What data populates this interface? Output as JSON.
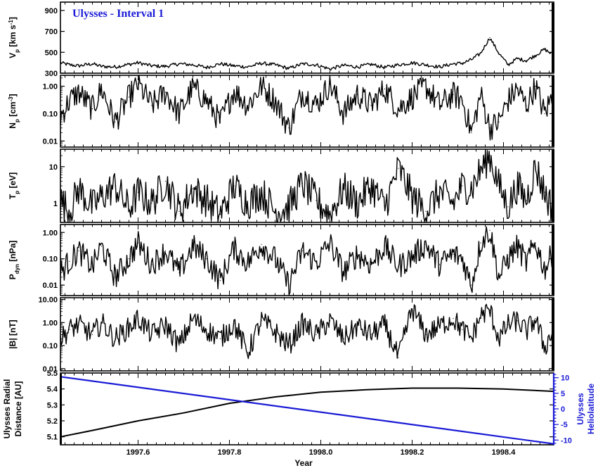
{
  "title": "Ulysses - Interval 1",
  "xlabel": "Year",
  "colors": {
    "trace": "#000000",
    "heliolatitude": "#1a1ad6"
  },
  "chart_data": [
    {
      "type": "line",
      "panel": "vp",
      "title": "Ulysses - Interval 1",
      "ylabel": "V_p [km s^-1]",
      "ylabel_parts": [
        "V",
        "p",
        " [km s",
        "-1",
        "]"
      ],
      "yscale": "linear",
      "ylim": [
        300,
        980
      ],
      "yticks": [
        300,
        500,
        700,
        900
      ],
      "ytick_labels": [
        "300",
        "500",
        "700",
        "900"
      ],
      "xlim": [
        1997.43,
        1998.51
      ],
      "x": [
        1997.43,
        1997.45,
        1997.47,
        1997.5,
        1997.52,
        1997.55,
        1997.58,
        1997.6,
        1997.63,
        1997.66,
        1997.69,
        1997.72,
        1997.75,
        1997.78,
        1997.81,
        1997.84,
        1997.87,
        1997.9,
        1997.93,
        1997.96,
        1997.99,
        1998.02,
        1998.05,
        1998.08,
        1998.11,
        1998.14,
        1998.17,
        1998.2,
        1998.23,
        1998.26,
        1998.29,
        1998.31,
        1998.33,
        1998.35,
        1998.37,
        1998.39,
        1998.41,
        1998.43,
        1998.45,
        1998.47,
        1998.49,
        1998.51
      ],
      "values": [
        400,
        380,
        370,
        390,
        365,
        360,
        385,
        400,
        370,
        365,
        390,
        380,
        355,
        390,
        370,
        360,
        395,
        380,
        345,
        390,
        380,
        340,
        375,
        360,
        385,
        355,
        380,
        400,
        380,
        360,
        390,
        395,
        430,
        490,
        640,
        490,
        380,
        440,
        420,
        470,
        530,
        470
      ]
    },
    {
      "type": "line",
      "panel": "np",
      "ylabel": "N_p [cm^-3]",
      "ylabel_parts": [
        "N",
        "p",
        " [cm",
        "-3",
        "]"
      ],
      "yscale": "log",
      "ylim": [
        0.006,
        2.5
      ],
      "yticks": [
        0.01,
        0.1,
        1.0
      ],
      "ytick_labels": [
        "0.01",
        "0.10",
        "1.00"
      ],
      "xlim": [
        1997.43,
        1998.51
      ],
      "x": [
        1997.43,
        1997.45,
        1997.47,
        1997.5,
        1997.52,
        1997.55,
        1997.58,
        1997.6,
        1997.63,
        1997.66,
        1997.69,
        1997.72,
        1997.75,
        1997.78,
        1997.81,
        1997.84,
        1997.87,
        1997.9,
        1997.93,
        1997.96,
        1997.99,
        1998.02,
        1998.05,
        1998.08,
        1998.11,
        1998.14,
        1998.17,
        1998.2,
        1998.23,
        1998.26,
        1998.29,
        1998.31,
        1998.33,
        1998.35,
        1998.37,
        1998.39,
        1998.41,
        1998.43,
        1998.45,
        1998.47,
        1998.49,
        1998.51
      ],
      "values": [
        0.08,
        0.3,
        0.6,
        0.15,
        0.8,
        0.05,
        0.4,
        1.2,
        0.2,
        0.6,
        0.1,
        0.9,
        0.3,
        0.05,
        0.7,
        0.2,
        1.0,
        0.3,
        0.03,
        0.6,
        0.2,
        1.2,
        0.1,
        0.5,
        0.2,
        0.8,
        0.15,
        0.4,
        1.0,
        0.2,
        0.5,
        0.3,
        0.02,
        0.5,
        0.03,
        0.05,
        0.3,
        0.8,
        0.2,
        1.0,
        0.1,
        0.6
      ]
    },
    {
      "type": "line",
      "panel": "tp",
      "ylabel": "T_p [eV]",
      "ylabel_parts": [
        "T",
        "p",
        " [eV]",
        "",
        ""
      ],
      "yscale": "log",
      "ylim": [
        0.3,
        30
      ],
      "yticks": [
        1,
        10
      ],
      "ytick_labels": [
        "1",
        "10"
      ],
      "xlim": [
        1997.43,
        1998.51
      ],
      "x": [
        1997.43,
        1997.45,
        1997.47,
        1997.5,
        1997.52,
        1997.55,
        1997.58,
        1997.6,
        1997.63,
        1997.66,
        1997.69,
        1997.72,
        1997.75,
        1997.78,
        1997.81,
        1997.84,
        1997.87,
        1997.9,
        1997.93,
        1997.96,
        1997.99,
        1998.02,
        1998.05,
        1998.08,
        1998.11,
        1998.14,
        1998.17,
        1998.2,
        1998.23,
        1998.26,
        1998.29,
        1998.31,
        1998.33,
        1998.35,
        1998.37,
        1998.39,
        1998.41,
        1998.43,
        1998.45,
        1998.47,
        1998.49,
        1998.51
      ],
      "values": [
        1.2,
        0.6,
        2.5,
        0.8,
        1.5,
        3.0,
        0.7,
        2.0,
        1.0,
        4.0,
        0.6,
        2.5,
        1.2,
        0.5,
        3.0,
        1.0,
        2.0,
        0.6,
        0.8,
        3.5,
        1.2,
        0.5,
        2.5,
        1.0,
        3.0,
        0.8,
        9.0,
        1.5,
        0.6,
        2.0,
        1.0,
        3.0,
        2.5,
        8.0,
        20.0,
        3.0,
        0.8,
        3.0,
        1.2,
        10.0,
        2.0,
        0.6
      ]
    },
    {
      "type": "line",
      "panel": "pdyn",
      "ylabel": "P_dyn [nPa]",
      "ylabel_parts": [
        "P",
        "dyn",
        " [nPa]",
        "",
        ""
      ],
      "yscale": "log",
      "ylim": [
        0.004,
        2.0
      ],
      "yticks": [
        0.01,
        0.1,
        1.0
      ],
      "ytick_labels": [
        "0.01",
        "0.10",
        "1.00"
      ],
      "xlim": [
        1997.43,
        1998.51
      ],
      "x": [
        1997.43,
        1997.45,
        1997.47,
        1997.5,
        1997.52,
        1997.55,
        1997.58,
        1997.6,
        1997.63,
        1997.66,
        1997.69,
        1997.72,
        1997.75,
        1997.78,
        1997.81,
        1997.84,
        1997.87,
        1997.9,
        1997.93,
        1997.96,
        1997.99,
        1998.02,
        1998.05,
        1998.08,
        1998.11,
        1998.14,
        1998.17,
        1998.2,
        1998.23,
        1998.26,
        1998.29,
        1998.31,
        1998.33,
        1998.35,
        1998.37,
        1998.39,
        1998.41,
        1998.43,
        1998.45,
        1998.47,
        1998.49,
        1998.51
      ],
      "values": [
        0.03,
        0.08,
        0.2,
        0.05,
        0.3,
        0.02,
        0.1,
        0.4,
        0.06,
        0.2,
        0.03,
        0.3,
        0.1,
        0.015,
        0.25,
        0.07,
        0.35,
        0.1,
        0.01,
        0.2,
        0.07,
        0.4,
        0.03,
        0.15,
        0.06,
        0.3,
        0.05,
        0.12,
        0.35,
        0.06,
        0.15,
        0.1,
        0.01,
        0.4,
        1.2,
        0.02,
        0.1,
        0.3,
        0.07,
        0.4,
        0.04,
        0.2
      ]
    },
    {
      "type": "line",
      "panel": "b",
      "ylabel": "|B| [nT]",
      "ylabel_parts": [
        "|B| [nT]",
        "",
        "",
        "",
        ""
      ],
      "yscale": "log",
      "ylim": [
        0.008,
        12
      ],
      "yticks": [
        0.01,
        0.1,
        1.0,
        10.0
      ],
      "ytick_labels": [
        "0.01",
        "0.10",
        "1.00",
        "10.00"
      ],
      "xlim": [
        1997.43,
        1998.51
      ],
      "x": [
        1997.43,
        1997.45,
        1997.47,
        1997.5,
        1997.52,
        1997.55,
        1997.58,
        1997.6,
        1997.63,
        1997.66,
        1997.69,
        1997.72,
        1997.75,
        1997.78,
        1997.81,
        1997.84,
        1997.87,
        1997.9,
        1997.93,
        1997.96,
        1997.99,
        1998.02,
        1998.05,
        1998.08,
        1998.11,
        1998.14,
        1998.17,
        1998.2,
        1998.23,
        1998.26,
        1998.29,
        1998.31,
        1998.33,
        1998.35,
        1998.37,
        1998.39,
        1998.41,
        1998.43,
        1998.45,
        1998.47,
        1998.49,
        1998.51
      ],
      "values": [
        0.2,
        0.5,
        0.8,
        0.3,
        1.0,
        0.2,
        0.6,
        1.5,
        0.3,
        0.8,
        0.1,
        1.5,
        0.5,
        0.2,
        0.9,
        0.05,
        1.2,
        0.4,
        0.1,
        0.9,
        0.3,
        1.2,
        0.2,
        0.7,
        0.3,
        0.8,
        0.03,
        4.0,
        0.3,
        0.7,
        1.5,
        0.5,
        0.2,
        2.0,
        3.5,
        0.2,
        0.8,
        1.2,
        0.4,
        1.5,
        0.08,
        0.5
      ]
    },
    {
      "type": "line",
      "panel": "orbit",
      "ylabel": "Ulysses Radial Distance [AU]",
      "ylabel_lines": [
        "Ulysses Radial",
        "Distance [AU]"
      ],
      "y2label": "Ulysses Heliolatitude",
      "y2label_lines": [
        "Ulysses",
        "Heliolatitude"
      ],
      "yscale": "linear",
      "ylim": [
        5.05,
        5.5
      ],
      "yticks": [
        5.1,
        5.2,
        5.3,
        5.4,
        5.5
      ],
      "ytick_labels": [
        "5.1",
        "5.2",
        "5.3",
        "5.4",
        "5.5"
      ],
      "y2lim": [
        -11.5,
        11.5
      ],
      "y2ticks": [
        -10,
        -5,
        0,
        5,
        10
      ],
      "y2tick_labels": [
        "-10",
        "-5",
        "0",
        "5",
        "10"
      ],
      "xlim": [
        1997.43,
        1998.51
      ],
      "xticks": [
        1997.6,
        1997.8,
        1998.0,
        1998.2,
        1998.4
      ],
      "xtick_labels": [
        "1997.6",
        "1997.8",
        "1998.0",
        "1998.2",
        "1998.4"
      ],
      "xlabel": "Year",
      "series": [
        {
          "name": "Ulysses Radial Distance [AU]",
          "axis": "left",
          "x": [
            1997.43,
            1997.5,
            1997.6,
            1997.7,
            1997.8,
            1997.9,
            1998.0,
            1998.1,
            1998.2,
            1998.3,
            1998.4,
            1998.51
          ],
          "values": [
            5.1,
            5.14,
            5.2,
            5.25,
            5.31,
            5.35,
            5.38,
            5.395,
            5.405,
            5.405,
            5.4,
            5.385
          ]
        },
        {
          "name": "Ulysses Heliolatitude",
          "axis": "right",
          "x": [
            1997.43,
            1998.51
          ],
          "values": [
            10.3,
            -11.2
          ]
        }
      ]
    }
  ]
}
